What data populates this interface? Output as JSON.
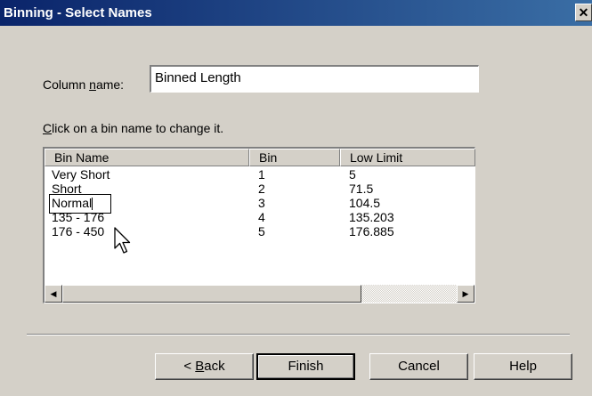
{
  "window": {
    "title": "Binning - Select Names",
    "close_glyph": "✕"
  },
  "column": {
    "label_prefix": "Column ",
    "label_key": "n",
    "label_suffix": "ame:",
    "value": "Binned Length"
  },
  "instruction": {
    "key": "C",
    "rest": "lick on a bin name to change it."
  },
  "table": {
    "headers": [
      "Bin Name",
      "Bin",
      "Low Limit"
    ],
    "rows": [
      {
        "name": "Very Short",
        "bin": "1",
        "low": "5"
      },
      {
        "name": "Short",
        "bin": "2",
        "low": "71.5"
      },
      {
        "name": "Normal",
        "bin": "3",
        "low": "104.5",
        "editing": true
      },
      {
        "name": "135 - 176",
        "bin": "4",
        "low": "135.203"
      },
      {
        "name": "176 - 450",
        "bin": "5",
        "low": "176.885"
      }
    ]
  },
  "scrollbar": {
    "left_arrow": "◀",
    "right_arrow": "▶"
  },
  "buttons": {
    "back_prefix": "< ",
    "back_key": "B",
    "back_rest": "ack",
    "finish": "Finish",
    "cancel": "Cancel",
    "help": "Help"
  }
}
